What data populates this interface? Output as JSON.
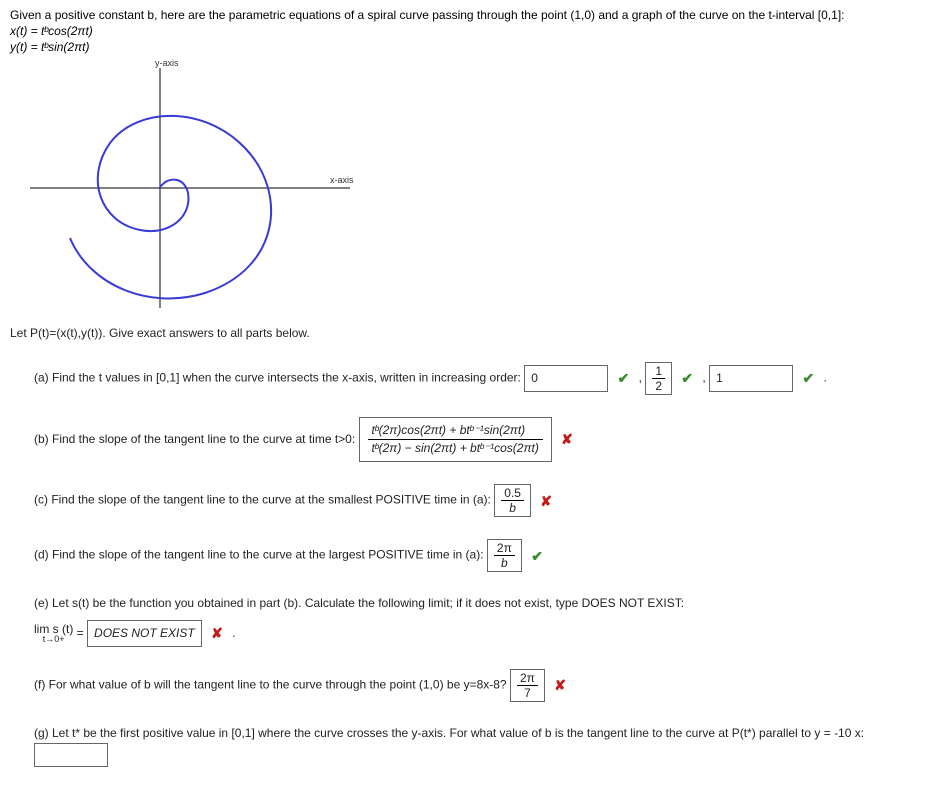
{
  "intro": {
    "line1": "Given a positive constant b, here are the parametric equations of a spiral curve passing through the point (1,0) and a graph of the curve on the t-interval [0,1]:",
    "eq_x": "x(t) = tᵇcos(2πt)",
    "eq_y": "y(t) = tᵇsin(2πt)",
    "y_axis_label": "y-axis",
    "x_axis_label": "x-axis"
  },
  "below_graph": "Let P(t)=(x(t),y(t)). Give exact answers to all parts below.",
  "a": {
    "prompt": "(a) Find the t values in [0,1] when the curve intersects the x-axis, written in increasing order:",
    "ans1": "0",
    "ans2_html": "½",
    "ans3": "1"
  },
  "b": {
    "prompt": "(b) Find the slope of the tangent line to the curve at time t>0:",
    "num": "tᵇ(2π)cos(2πt) + btᵇ⁻¹sin(2πt)",
    "den": "tᵇ(2π) − sin(2πt) + btᵇ⁻¹cos(2πt)"
  },
  "c": {
    "prompt": "(c) Find the slope of the tangent line to the curve at the smallest POSITIVE time in (a):",
    "num": "0.5",
    "den": "b"
  },
  "d": {
    "prompt": "(d) Find the slope of the tangent line to the curve at the largest POSITIVE time in (a):",
    "num": "2π",
    "den": "b"
  },
  "e": {
    "prompt": "(e) Let s(t) be the function you obtained in part (b). Calculate the following limit; if it does not exist, type DOES NOT EXIST:",
    "limit_label_top": "lim s (t)",
    "limit_label_bottom": "t→0+",
    "equals": "=",
    "ans": "DOES NOT EXIST"
  },
  "f": {
    "prompt": "(f) For what value of b will the tangent line to the curve through the point (1,0) be y=8x-8?",
    "num": "2π",
    "den": "7"
  },
  "g": {
    "prompt": "(g) Let t* be the first positive value in [0,1] where the curve crosses the y-axis. For what value of b is the tangent line to the curve at P(t*) parallel to y = -10 x:",
    "ans": ""
  },
  "marks": {
    "correct": "✔",
    "wrong": "✘"
  }
}
